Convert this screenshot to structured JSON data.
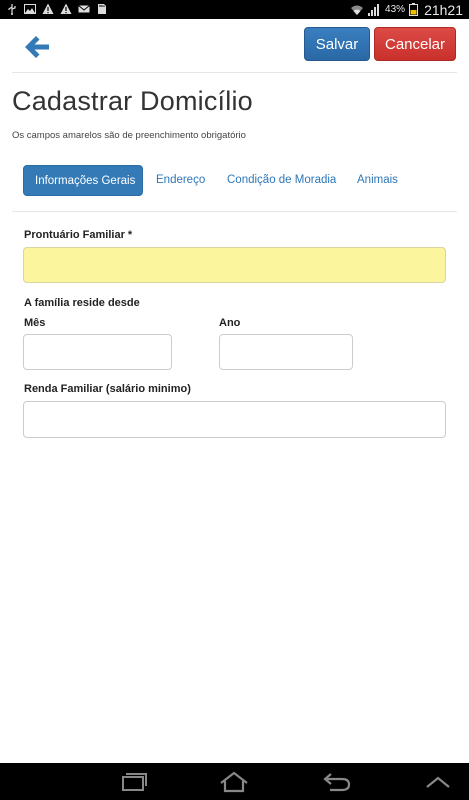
{
  "status_bar": {
    "icons_left": [
      "usb-icon",
      "image-icon",
      "warning-icon",
      "warning-icon",
      "mail-icon",
      "sd-card-icon"
    ],
    "icons_right": [
      "wifi-icon",
      "signal-icon",
      "battery-icon"
    ],
    "battery_percent": "43%",
    "clock": "21h21"
  },
  "header": {
    "back_icon": "arrow-left-icon",
    "save_label": "Salvar",
    "cancel_label": "Cancelar",
    "save_color": "#337ab7",
    "cancel_color": "#d9534f"
  },
  "page": {
    "title": "Cadastrar Domicílio",
    "subtitle": "Os campos amarelos são de preenchimento obrigatório"
  },
  "tabs": [
    {
      "label": "Informações Gerais",
      "active": true
    },
    {
      "label": "Endereço",
      "active": false
    },
    {
      "label": "Condição de Moradia",
      "active": false
    },
    {
      "label": "Animais",
      "active": false
    }
  ],
  "form": {
    "prontuario": {
      "label": "Prontuário Familiar *",
      "value": "",
      "required_color": "#fbf59e"
    },
    "reside_desde": {
      "label": "A família reside desde",
      "mes": {
        "label": "Mês",
        "value": ""
      },
      "ano": {
        "label": "Ano",
        "value": ""
      }
    },
    "renda": {
      "label": "Renda Familiar (salário minimo)",
      "value": ""
    }
  },
  "nav_bar": {
    "icons": [
      "recent-apps-icon",
      "home-icon",
      "back-nav-icon",
      "chevron-up-icon"
    ]
  }
}
